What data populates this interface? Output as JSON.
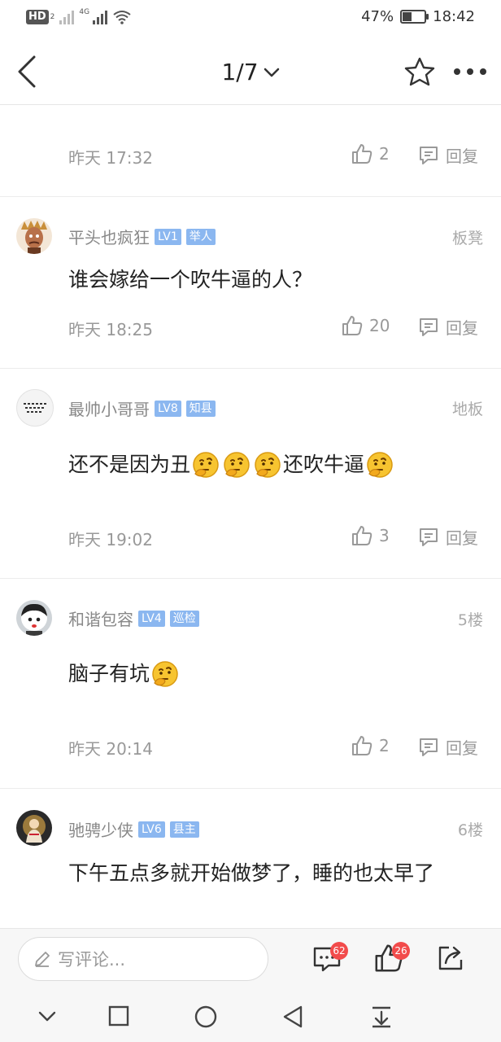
{
  "status_bar": {
    "hd_label": "HD",
    "hd_sub": "2",
    "net_label": "4G",
    "battery_text": "47%",
    "battery_level": 0.47,
    "time": "18:42"
  },
  "nav": {
    "pager": "1/7",
    "icons": [
      "back-icon",
      "chevron-down-icon",
      "star-icon",
      "more-icon"
    ]
  },
  "prev_post": {
    "time": "昨天 17:32",
    "likes": "2",
    "reply_label": "回复"
  },
  "comments": [
    {
      "username": "平头也疯狂",
      "level": "LV1",
      "title": "举人",
      "floor": "板凳",
      "segments": [
        {
          "t": "text",
          "v": "谁会嫁给一个吹牛逼的人？"
        }
      ],
      "time": "昨天 18:25",
      "likes": "20",
      "reply_label": "回复",
      "avatar_icon": "avatar-warrior"
    },
    {
      "username": "最帅小哥哥",
      "level": "LV8",
      "title": "知县",
      "floor": "地板",
      "segments": [
        {
          "t": "text",
          "v": "还不是因为丑"
        },
        {
          "t": "emoji",
          "v": "thinking-emoji"
        },
        {
          "t": "emoji",
          "v": "thinking-emoji"
        },
        {
          "t": "emoji",
          "v": "thinking-emoji"
        },
        {
          "t": "text",
          "v": "还吹牛逼"
        },
        {
          "t": "emoji",
          "v": "thinking-emoji"
        }
      ],
      "time": "昨天 19:02",
      "likes": "3",
      "reply_label": "回复",
      "avatar_icon": "avatar-text"
    },
    {
      "username": "和谐包容",
      "level": "LV4",
      "title": "巡检",
      "floor": "5楼",
      "segments": [
        {
          "t": "text",
          "v": "脑子有坑"
        },
        {
          "t": "emoji",
          "v": "thinking-emoji"
        }
      ],
      "time": "昨天 20:14",
      "likes": "2",
      "reply_label": "回复",
      "avatar_icon": "avatar-cartoon"
    },
    {
      "username": "驰骋少侠",
      "level": "LV6",
      "title": "县主",
      "floor": "6楼",
      "segments": [
        {
          "t": "text",
          "v": "下午五点多就开始做梦了，睡的也太早了"
        }
      ],
      "avatar_icon": "avatar-buddha"
    }
  ],
  "comment_bar": {
    "placeholder": "写评论...",
    "comment_count": "62",
    "like_count": "26"
  },
  "colors": {
    "badge_red": "#f24b4b",
    "tag_blue": "#8bb7f0",
    "meta_gray": "#999999"
  }
}
